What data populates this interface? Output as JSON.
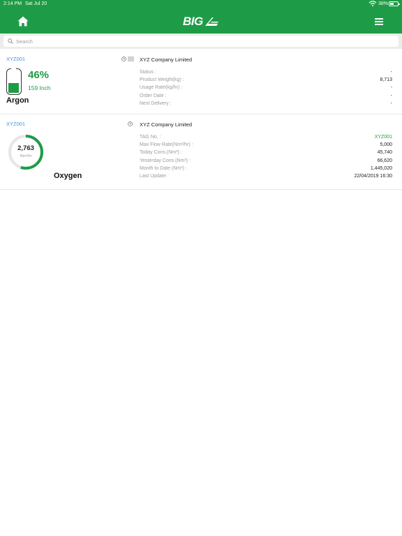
{
  "status_bar": {
    "time": "2:14 PM",
    "date": "Sat Jul 20",
    "battery": "38%"
  },
  "nav": {
    "logo_text": "BIG"
  },
  "search": {
    "placeholder": "Search"
  },
  "cards": [
    {
      "tag": "XYZ001",
      "company": "XYZ Company Limited",
      "level_percent": "46%",
      "level_fraction": 0.46,
      "level_inch": "159 Inch",
      "gas": "Argon",
      "details": [
        {
          "label": "Status :",
          "value": "-"
        },
        {
          "label": "Product Weight(kg) :",
          "value": "8,713"
        },
        {
          "label": "Usage Rate(kg/hr) :",
          "value": "-"
        },
        {
          "label": "Order Date :",
          "value": "-"
        },
        {
          "label": "Next Delivery :",
          "value": "-"
        }
      ]
    },
    {
      "tag": "XYZ001",
      "company": "XYZ Company Limited",
      "gauge_value": "2,763",
      "gauge_unit": "Nm³/hr",
      "gauge_fraction": 0.55,
      "gas": "Oxygen",
      "details": [
        {
          "label": "TAG No. :",
          "value": "XYZ001"
        },
        {
          "label": "Max Flow Rate(Nm³/hr) :",
          "value": "5,000"
        },
        {
          "label": "Today Cons.(Nm³) :",
          "value": "45,740"
        },
        {
          "label": "Yesterday Cons.(Nm³) :",
          "value": "66,620"
        },
        {
          "label": "Month to Date (Nm³) :",
          "value": "1,445,020"
        },
        {
          "label": "Last Update :",
          "value": "22/04/2019 16:30"
        }
      ]
    }
  ],
  "colors": {
    "brand": "#1e9b47",
    "link": "#4a90d9",
    "muted": "#9b9b9b"
  },
  "icons": [
    "home-icon",
    "menu-icon",
    "search-icon",
    "clock-icon",
    "list-icon",
    "wifi-icon",
    "battery-icon"
  ]
}
